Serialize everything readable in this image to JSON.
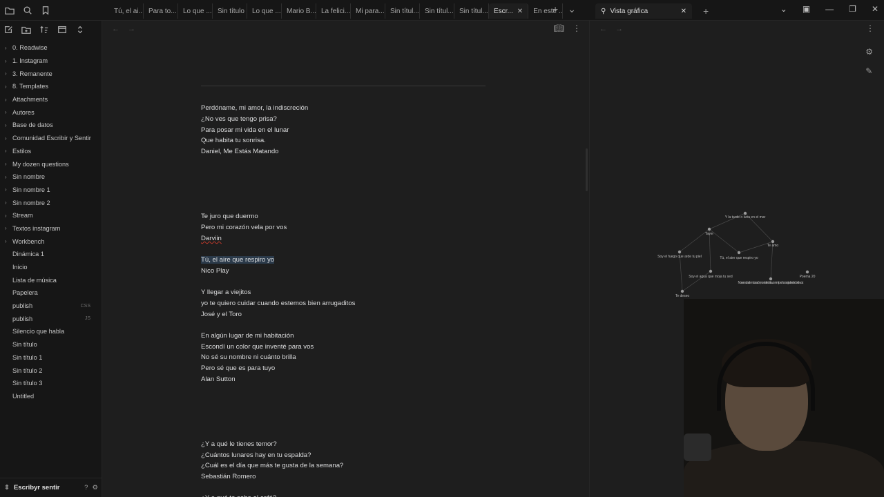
{
  "tabs": [
    {
      "label": "Tú, el ai..."
    },
    {
      "label": "Para to..."
    },
    {
      "label": "Lo que ..."
    },
    {
      "label": "Sin título"
    },
    {
      "label": "Lo que ..."
    },
    {
      "label": "Mario B..."
    },
    {
      "label": "La felici..."
    },
    {
      "label": "Mi para..."
    },
    {
      "label": "Sin títul..."
    },
    {
      "label": "Sin títul..."
    },
    {
      "label": "Sin títul..."
    },
    {
      "label": "Escr...",
      "active": true
    },
    {
      "label": "En este ..."
    }
  ],
  "right_tab": {
    "label": "Vista gráfica"
  },
  "sidebar": {
    "items": [
      {
        "label": "0. Readwise",
        "folder": true
      },
      {
        "label": "1. Instagram",
        "folder": true
      },
      {
        "label": "3. Remanente",
        "folder": true
      },
      {
        "label": "8. Templates",
        "folder": true
      },
      {
        "label": "Attachments",
        "folder": true
      },
      {
        "label": "Autores",
        "folder": true
      },
      {
        "label": "Base de datos",
        "folder": true
      },
      {
        "label": "Comunidad Escribir y Sentir",
        "folder": true
      },
      {
        "label": "Estilos",
        "folder": true
      },
      {
        "label": "My dozen questions",
        "folder": true
      },
      {
        "label": "Sin nombre",
        "folder": true
      },
      {
        "label": "Sin nombre 1",
        "folder": true
      },
      {
        "label": "Sin nombre 2",
        "folder": true
      },
      {
        "label": "Stream",
        "folder": true
      },
      {
        "label": "Textos instagram",
        "folder": true
      },
      {
        "label": "Workbench",
        "folder": true
      },
      {
        "label": "Dinámica 1",
        "folder": false
      },
      {
        "label": "Inicio",
        "folder": false
      },
      {
        "label": "Lista de música",
        "folder": false
      },
      {
        "label": "Papelera",
        "folder": false
      },
      {
        "label": "publish",
        "folder": false,
        "ext": "CSS"
      },
      {
        "label": "publish",
        "folder": false,
        "ext": "JS"
      },
      {
        "label": "Silencio que habla",
        "folder": false
      },
      {
        "label": "Sin título",
        "folder": false
      },
      {
        "label": "Sin título 1",
        "folder": false
      },
      {
        "label": "Sin título 2",
        "folder": false
      },
      {
        "label": "Sin título 3",
        "folder": false
      },
      {
        "label": "Untitled",
        "folder": false
      }
    ],
    "vault_name": "Escribyr sentir"
  },
  "editor": {
    "lines": [
      "Perdóname, mi amor, la indiscreción",
      "¿No ves que tengo prisa?",
      "Para posar mi vida en el lunar",
      "Que habita tu sonrisa.",
      "Daniel, Me Estás Matando",
      "Te juro que duermo",
      "Pero mi corazón vela por vos",
      "Darviin",
      "Tú, el aire que respiro yo",
      "Nico Play",
      "Y llegar a viejitos",
      "yo te quiero cuidar cuando estemos bien arrugaditos",
      "José y el Toro",
      "En algún lugar de mi habitación",
      "Escondí un color que inventé para vos",
      "No sé su nombre ni cuánto brilla",
      "Pero sé que es para tuyo",
      "Alan Sutton",
      "¿Y a qué le tienes temor?",
      "¿Cuántos lunares hay en tu espalda?",
      "¿Cuál es el día que más te gusta de la semana?",
      "Sebastián Romero",
      "¿Y a qué te sabe el café?"
    ]
  },
  "graph": {
    "nodes": [
      {
        "label": "Y la tarde o luna en el mar"
      },
      {
        "label": "Tayer"
      },
      {
        "label": "Te amo"
      },
      {
        "label": "Soy el fuego que arde tu piel"
      },
      {
        "label": "Tú, el aire que respiro yo"
      },
      {
        "label": "Soy el agua que moja tu sed"
      },
      {
        "label": "Poema 20"
      },
      {
        "label": "No se nada de mi corazón, no sé si te detuvo en mi pecho o viaja al rededor de voz"
      },
      {
        "label": "Te deseo"
      }
    ]
  },
  "colors": {
    "accent": "#7f6df2",
    "highlight": "#2b3a4a"
  }
}
